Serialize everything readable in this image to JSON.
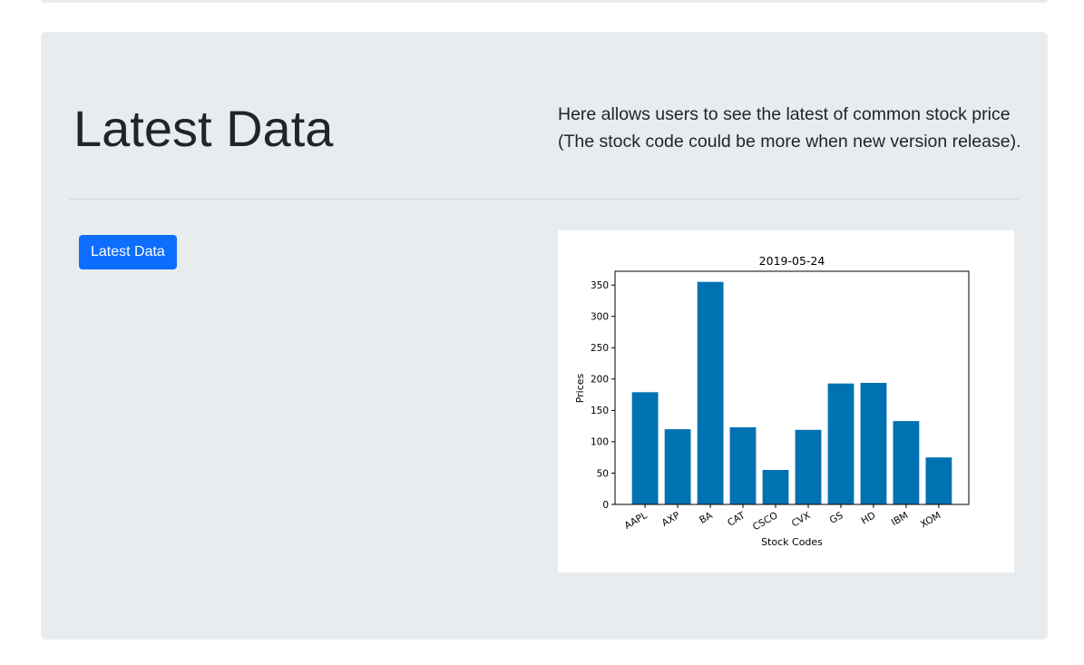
{
  "header": {
    "title": "Latest Data",
    "description": "Here allows users to see the latest of common stock price (The stock code could be more when new version release)."
  },
  "actions": {
    "latest_button_label": "Latest Data"
  },
  "colors": {
    "background": "#e9ecef",
    "button": "#0d6efd",
    "bar": "#0072b2"
  },
  "chart_data": {
    "type": "bar",
    "title": "2019-05-24",
    "xlabel": "Stock Codes",
    "ylabel": "Prices",
    "categories": [
      "AAPL",
      "AXP",
      "BA",
      "CAT",
      "CSCO",
      "CVX",
      "GS",
      "HD",
      "IBM",
      "XOM"
    ],
    "values": [
      179,
      120,
      355,
      123,
      55,
      119,
      193,
      194,
      133,
      75
    ],
    "ylim": [
      0,
      372
    ],
    "yticks": [
      0,
      50,
      100,
      150,
      200,
      250,
      300,
      350
    ],
    "grid": false,
    "xtick_rotation": 30
  }
}
